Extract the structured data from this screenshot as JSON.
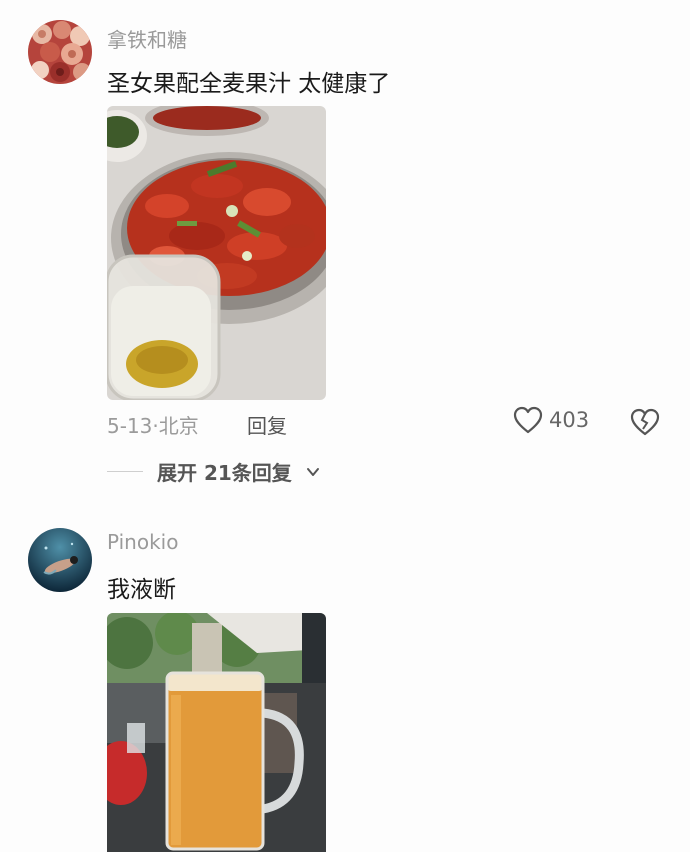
{
  "comments": [
    {
      "username": "拿铁和糖",
      "text": "圣女果配全麦果汁 太健康了",
      "date": "5-13",
      "location": "北京",
      "reply_label": "回复",
      "likes": "403",
      "expand_label": "展开 21条回复",
      "avatar_icon": "rose-bouquet-avatar",
      "image_icon": "crayfish-and-beer-photo"
    },
    {
      "username": "Pinokio",
      "text": "我液断",
      "avatar_icon": "underwater-swimmer-avatar",
      "image_icon": "beer-mug-photo"
    }
  ],
  "colors": {
    "background": "#fdfdfd",
    "muted_text": "#9b9b9b",
    "body_text": "#1a1a1a"
  }
}
